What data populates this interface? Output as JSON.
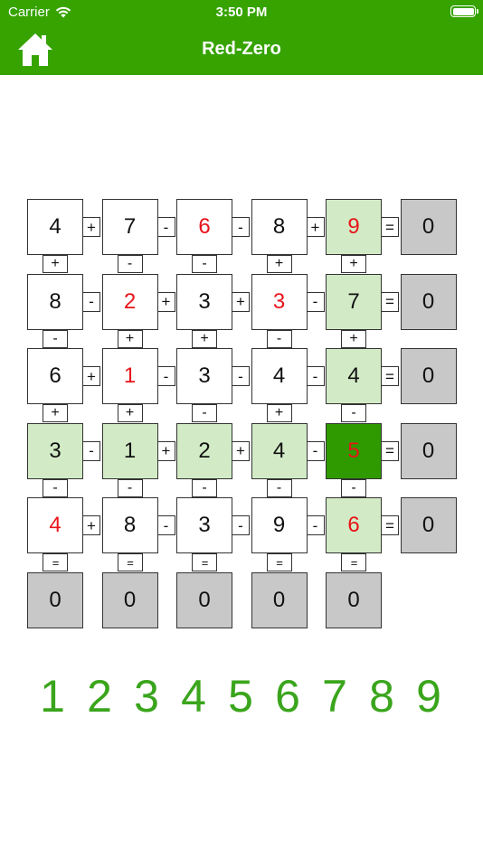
{
  "status_bar": {
    "carrier": "Carrier",
    "time": "3:50 PM"
  },
  "nav": {
    "title": "Red-Zero",
    "home_icon": "home-icon"
  },
  "colors": {
    "header": "#36a300",
    "given_digit": "#111111",
    "user_digit": "#e8141b",
    "highlight": "#d2ebc6",
    "selected": "#2f9a00",
    "sum_cell": "#c8c8c8",
    "picker_digit": "#3aa51c"
  },
  "grid": {
    "rows": [
      {
        "cells": [
          {
            "value": "4",
            "kind": "given",
            "state": ""
          },
          {
            "value": "7",
            "kind": "given",
            "state": ""
          },
          {
            "value": "6",
            "kind": "user",
            "state": ""
          },
          {
            "value": "8",
            "kind": "given",
            "state": ""
          },
          {
            "value": "9",
            "kind": "user",
            "state": "highlight"
          }
        ],
        "ops": [
          "+",
          "-",
          "-",
          "+"
        ],
        "equals": "=",
        "result": "0"
      },
      {
        "cells": [
          {
            "value": "8",
            "kind": "given",
            "state": ""
          },
          {
            "value": "2",
            "kind": "user",
            "state": ""
          },
          {
            "value": "3",
            "kind": "given",
            "state": ""
          },
          {
            "value": "3",
            "kind": "user",
            "state": ""
          },
          {
            "value": "7",
            "kind": "given",
            "state": "highlight"
          }
        ],
        "ops": [
          "-",
          "+",
          "+",
          "-"
        ],
        "equals": "=",
        "result": "0"
      },
      {
        "cells": [
          {
            "value": "6",
            "kind": "given",
            "state": ""
          },
          {
            "value": "1",
            "kind": "user",
            "state": ""
          },
          {
            "value": "3",
            "kind": "given",
            "state": ""
          },
          {
            "value": "4",
            "kind": "given",
            "state": ""
          },
          {
            "value": "4",
            "kind": "given",
            "state": "highlight"
          }
        ],
        "ops": [
          "+",
          "-",
          "-",
          "-"
        ],
        "equals": "=",
        "result": "0"
      },
      {
        "cells": [
          {
            "value": "3",
            "kind": "given",
            "state": "highlight"
          },
          {
            "value": "1",
            "kind": "given",
            "state": "highlight"
          },
          {
            "value": "2",
            "kind": "given",
            "state": "highlight"
          },
          {
            "value": "4",
            "kind": "given",
            "state": "highlight"
          },
          {
            "value": "5",
            "kind": "user",
            "state": "selected"
          }
        ],
        "ops": [
          "-",
          "+",
          "+",
          "-"
        ],
        "equals": "=",
        "result": "0"
      },
      {
        "cells": [
          {
            "value": "4",
            "kind": "user",
            "state": ""
          },
          {
            "value": "8",
            "kind": "given",
            "state": ""
          },
          {
            "value": "3",
            "kind": "given",
            "state": ""
          },
          {
            "value": "9",
            "kind": "given",
            "state": ""
          },
          {
            "value": "6",
            "kind": "user",
            "state": "highlight"
          }
        ],
        "ops": [
          "+",
          "-",
          "-",
          "-"
        ],
        "equals": "=",
        "result": "0"
      }
    ],
    "vertical_ops": [
      [
        "+",
        "-",
        "-",
        "+",
        "+"
      ],
      [
        "-",
        "+",
        "+",
        "-",
        "+"
      ],
      [
        "+",
        "+",
        "-",
        "+",
        "-"
      ],
      [
        "-",
        "-",
        "-",
        "-",
        "-"
      ]
    ],
    "column_equals": [
      "=",
      "=",
      "=",
      "=",
      "="
    ],
    "column_results": [
      "0",
      "0",
      "0",
      "0",
      "0"
    ]
  },
  "picker": {
    "digits": [
      "1",
      "2",
      "3",
      "4",
      "5",
      "6",
      "7",
      "8",
      "9"
    ]
  }
}
